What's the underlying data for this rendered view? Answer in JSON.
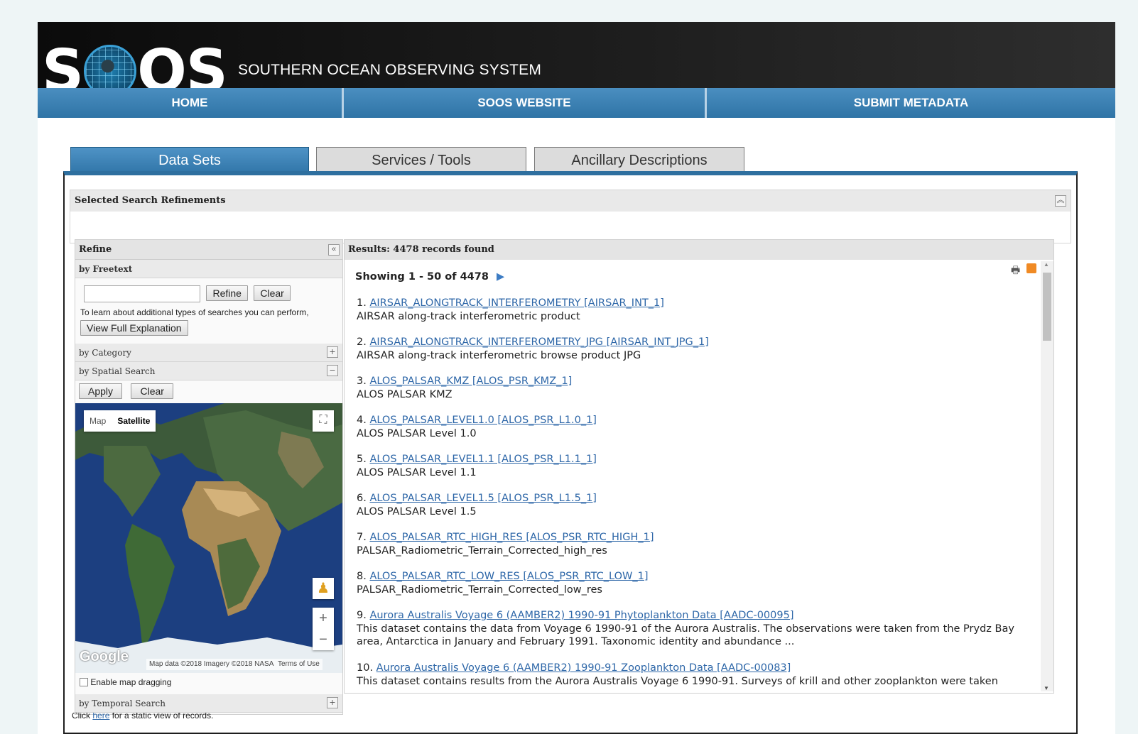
{
  "header": {
    "logo_text_a": "S",
    "logo_text_b": "OS",
    "site_title": "SOUTHERN OCEAN OBSERVING SYSTEM"
  },
  "nav": {
    "items": [
      "HOME",
      "SOOS WEBSITE",
      "SUBMIT METADATA"
    ]
  },
  "tabs": [
    "Data Sets",
    "Services / Tools",
    "Ancillary Descriptions"
  ],
  "refinements": {
    "title": "Selected Search Refinements",
    "collapse_icon": "double-chevron-up-icon"
  },
  "refine": {
    "title": "Refine",
    "freetext": {
      "heading": "by Freetext",
      "input_value": "",
      "refine_label": "Refine",
      "clear_label": "Clear",
      "help_text": "To learn about additional types of searches you can perform,",
      "explain_label": "View Full Explanation"
    },
    "category": {
      "heading": "by Category"
    },
    "spatial": {
      "heading": "by Spatial Search",
      "apply_label": "Apply",
      "clear_label": "Clear",
      "map_tab": "Map",
      "satellite_tab": "Satellite",
      "google_label": "Google",
      "attribution": "Map data ©2018 Imagery ©2018 NASA",
      "terms": "Terms of Use",
      "drag_label": "Enable map dragging"
    },
    "temporal": {
      "heading": "by Temporal Search"
    },
    "static_prefix": "Click",
    "static_link": "here",
    "static_suffix": "for a static view of records."
  },
  "results": {
    "header": "Results: 4478 records found",
    "showing": "Showing 1 - 50 of 4478",
    "items": [
      {
        "num": "1.",
        "title": "AIRSAR_ALONGTRACK_INTERFEROMETRY [AIRSAR_INT_1]",
        "desc": "AIRSAR along-track interferometric product"
      },
      {
        "num": "2.",
        "title": "AIRSAR_ALONGTRACK_INTERFEROMETRY_JPG [AIRSAR_INT_JPG_1]",
        "desc": "AIRSAR along-track interferometric browse product JPG"
      },
      {
        "num": "3.",
        "title": "ALOS_PALSAR_KMZ [ALOS_PSR_KMZ_1]",
        "desc": "ALOS PALSAR KMZ"
      },
      {
        "num": "4.",
        "title": "ALOS_PALSAR_LEVEL1.0 [ALOS_PSR_L1.0_1]",
        "desc": "ALOS PALSAR Level 1.0"
      },
      {
        "num": "5.",
        "title": "ALOS_PALSAR_LEVEL1.1 [ALOS_PSR_L1.1_1]",
        "desc": "ALOS PALSAR Level 1.1"
      },
      {
        "num": "6.",
        "title": "ALOS_PALSAR_LEVEL1.5 [ALOS_PSR_L1.5_1]",
        "desc": "ALOS PALSAR Level 1.5"
      },
      {
        "num": "7.",
        "title": "ALOS_PALSAR_RTC_HIGH_RES [ALOS_PSR_RTC_HIGH_1]",
        "desc": "PALSAR_Radiometric_Terrain_Corrected_high_res"
      },
      {
        "num": "8.",
        "title": "ALOS_PALSAR_RTC_LOW_RES [ALOS_PSR_RTC_LOW_1]",
        "desc": "PALSAR_Radiometric_Terrain_Corrected_low_res"
      },
      {
        "num": "9.",
        "title": "Aurora Australis Voyage 6 (AAMBER2) 1990-91 Phytoplankton Data [AADC-00095]",
        "desc": "This dataset contains the data from Voyage 6 1990-91 of the Aurora Australis. The observations were taken from the Prydz Bay area, Antarctica in January and February 1991. Taxonomic identity and abundance ..."
      },
      {
        "num": "10.",
        "title": "Aurora Australis Voyage 6 (AAMBER2) 1990-91 Zooplankton Data [AADC-00083]",
        "desc": "This dataset contains results from the Aurora Australis Voyage 6 1990-91. Surveys of krill and other zooplankton were taken"
      }
    ]
  }
}
